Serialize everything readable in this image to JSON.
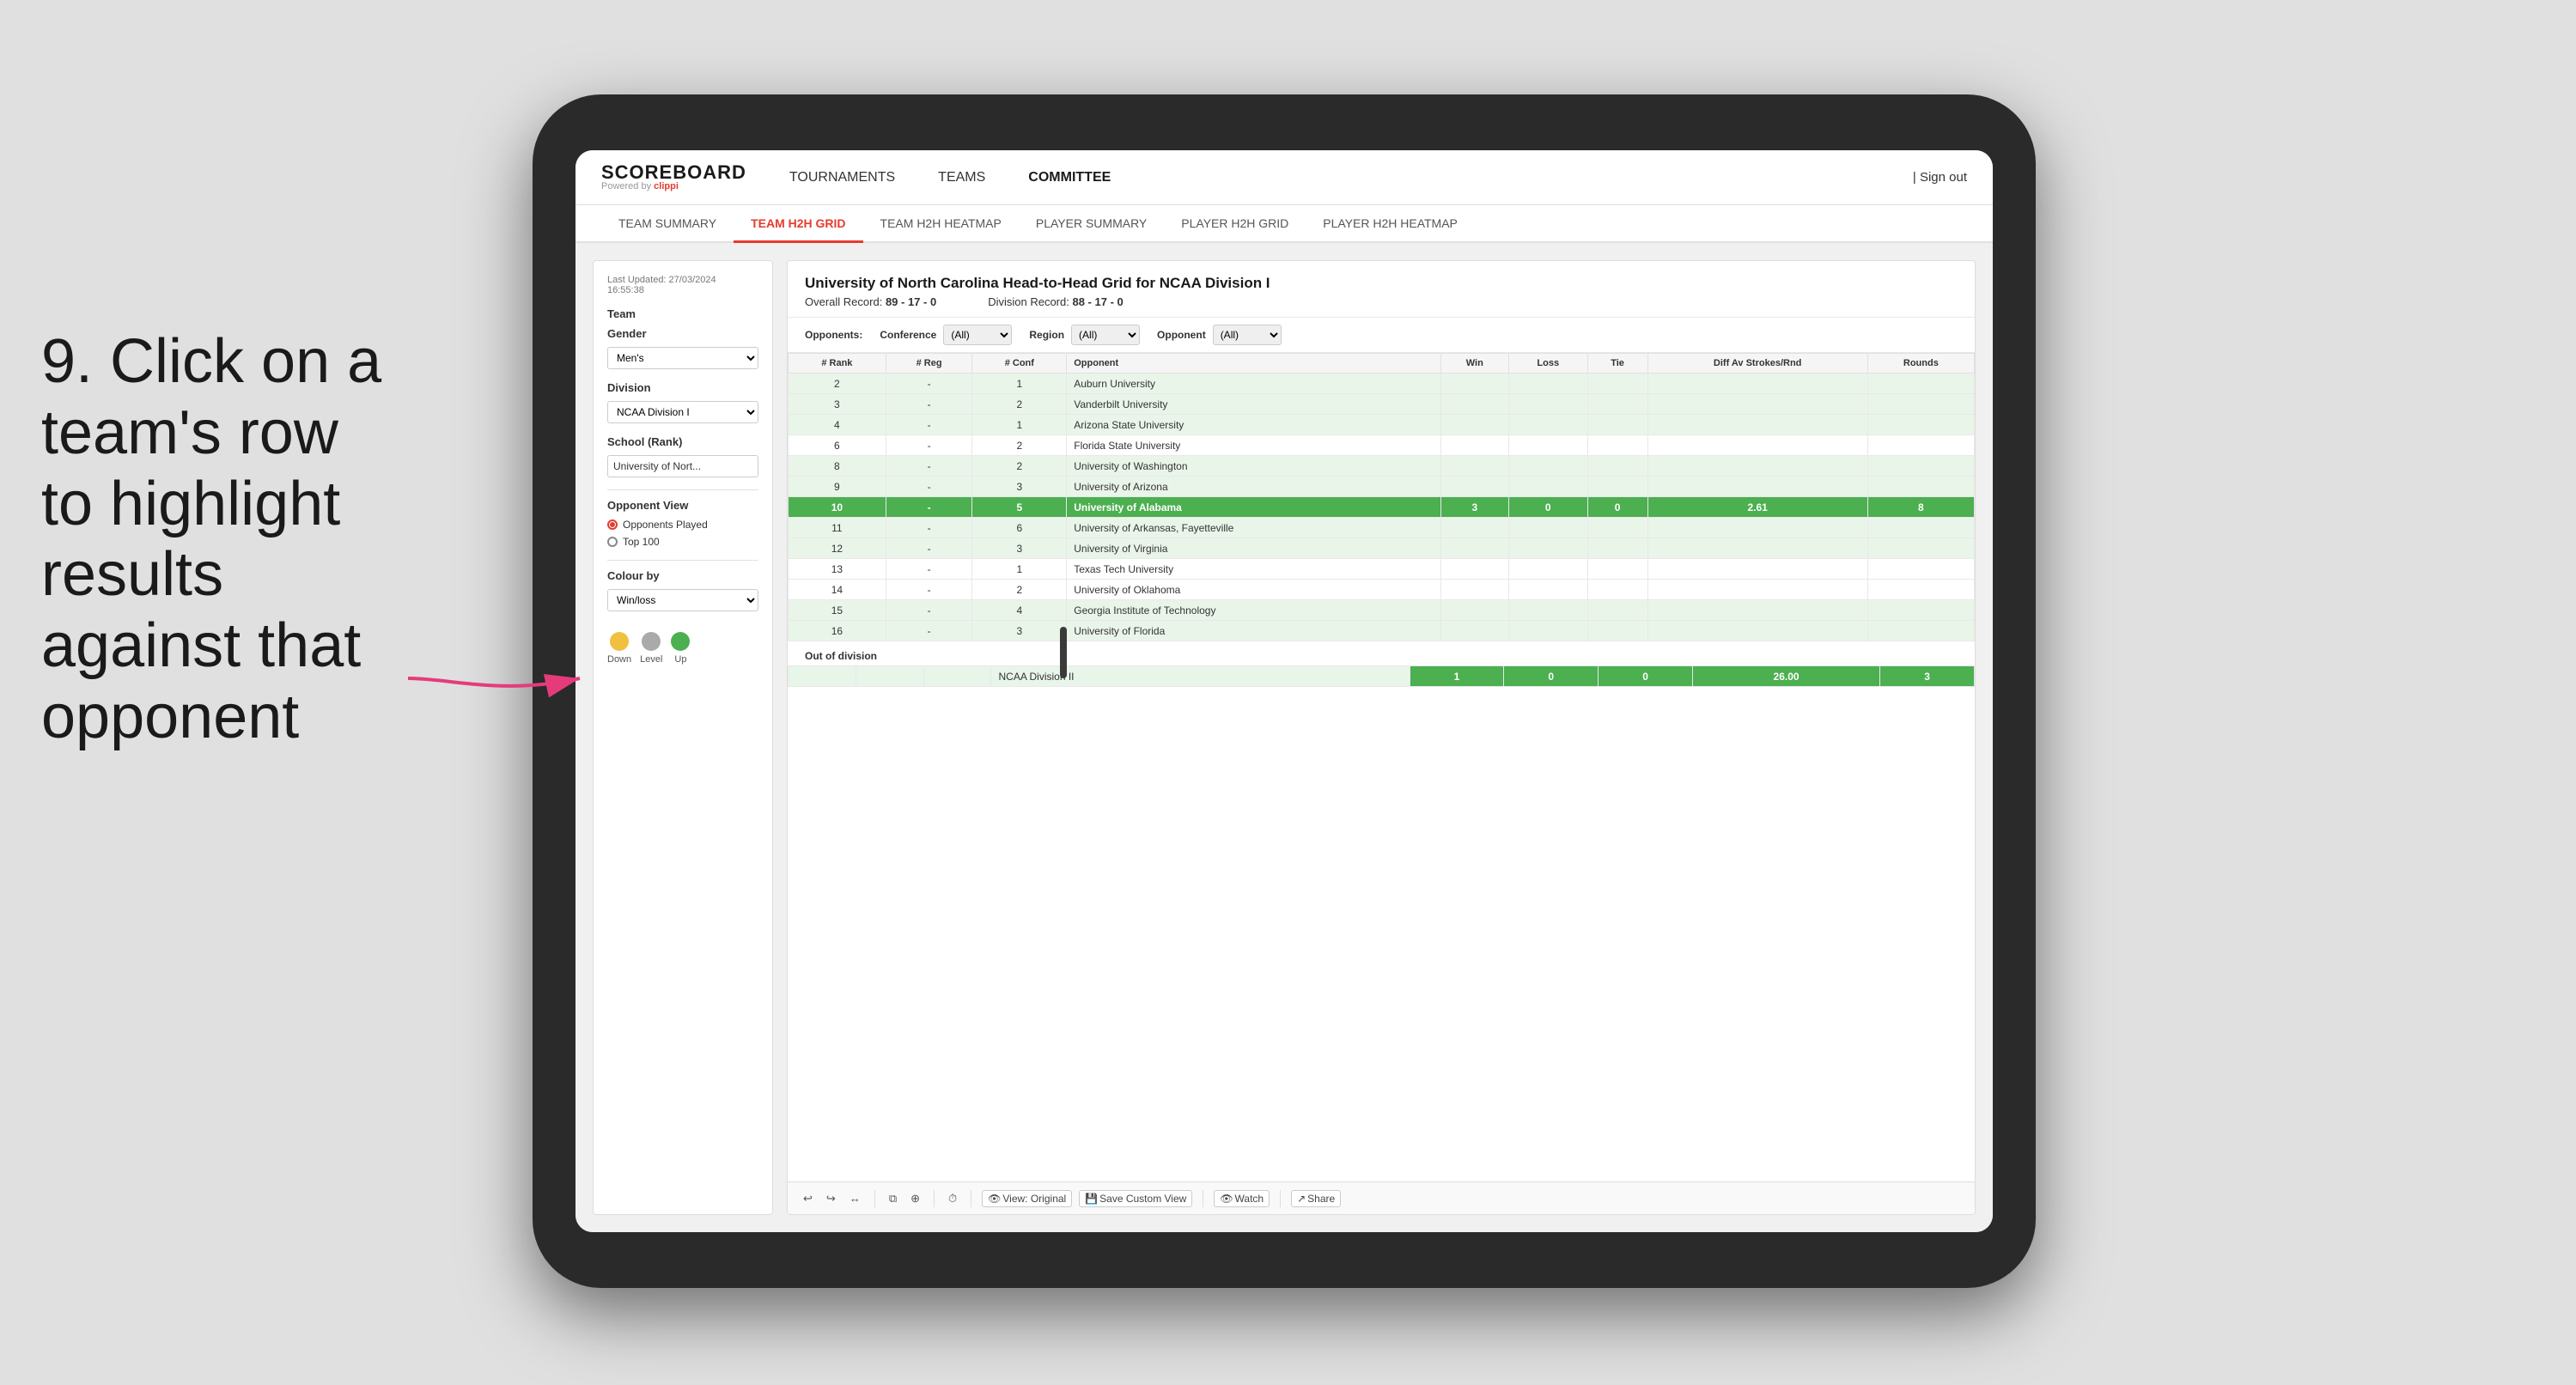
{
  "annotation": {
    "text": "9. Click on a team's row to highlight results against that opponent"
  },
  "nav": {
    "logo": "SCOREBOARD",
    "powered_by": "Powered by",
    "brand": "clippi",
    "links": [
      "TOURNAMENTS",
      "TEAMS",
      "COMMITTEE"
    ],
    "sign_in": "| Sign out"
  },
  "sub_tabs": [
    {
      "label": "TEAM SUMMARY",
      "active": false
    },
    {
      "label": "TEAM H2H GRID",
      "active": true
    },
    {
      "label": "TEAM H2H HEATMAP",
      "active": false
    },
    {
      "label": "PLAYER SUMMARY",
      "active": false
    },
    {
      "label": "PLAYER H2H GRID",
      "active": false
    },
    {
      "label": "PLAYER H2H HEATMAP",
      "active": false
    }
  ],
  "sidebar": {
    "last_updated": "Last Updated: 27/03/2024",
    "time": "16:55:38",
    "team_label": "Team",
    "gender_label": "Gender",
    "gender_value": "Men's",
    "division_label": "Division",
    "division_value": "NCAA Division I",
    "school_label": "School (Rank)",
    "school_value": "University of Nort...",
    "opponent_view_label": "Opponent View",
    "radio_1": "Opponents Played",
    "radio_2": "Top 100",
    "colour_by_label": "Colour by",
    "colour_by_value": "Win/loss",
    "legend_down": "Down",
    "legend_level": "Level",
    "legend_up": "Up"
  },
  "grid": {
    "title": "University of North Carolina Head-to-Head Grid for NCAA Division I",
    "overall_record_label": "Overall Record:",
    "overall_record_value": "89 - 17 - 0",
    "division_record_label": "Division Record:",
    "division_record_value": "88 - 17 - 0",
    "filters": {
      "opponents_label": "Opponents:",
      "conference_label": "Conference",
      "conference_value": "(All)",
      "region_label": "Region",
      "region_value": "(All)",
      "opponent_label": "Opponent",
      "opponent_value": "(All)"
    },
    "columns": [
      "# Rank",
      "# Reg",
      "# Conf",
      "Opponent",
      "Win",
      "Loss",
      "Tie",
      "Diff Av Strokes/Rnd",
      "Rounds"
    ],
    "rows": [
      {
        "rank": "2",
        "reg": "-",
        "conf": "1",
        "opponent": "Auburn University",
        "win": "",
        "loss": "",
        "tie": "",
        "diff": "",
        "rounds": "",
        "highlight": "light"
      },
      {
        "rank": "3",
        "reg": "-",
        "conf": "2",
        "opponent": "Vanderbilt University",
        "win": "",
        "loss": "",
        "tie": "",
        "diff": "",
        "rounds": "",
        "highlight": "light"
      },
      {
        "rank": "4",
        "reg": "-",
        "conf": "1",
        "opponent": "Arizona State University",
        "win": "",
        "loss": "",
        "tie": "",
        "diff": "",
        "rounds": "",
        "highlight": "light"
      },
      {
        "rank": "6",
        "reg": "-",
        "conf": "2",
        "opponent": "Florida State University",
        "win": "",
        "loss": "",
        "tie": "",
        "diff": "",
        "rounds": "",
        "highlight": "none"
      },
      {
        "rank": "8",
        "reg": "-",
        "conf": "2",
        "opponent": "University of Washington",
        "win": "",
        "loss": "",
        "tie": "",
        "diff": "",
        "rounds": "",
        "highlight": "light"
      },
      {
        "rank": "9",
        "reg": "-",
        "conf": "3",
        "opponent": "University of Arizona",
        "win": "",
        "loss": "",
        "tie": "",
        "diff": "",
        "rounds": "",
        "highlight": "light"
      },
      {
        "rank": "10",
        "reg": "-",
        "conf": "5",
        "opponent": "University of Alabama",
        "win": "3",
        "loss": "0",
        "tie": "0",
        "diff": "2.61",
        "rounds": "8",
        "highlight": "green"
      },
      {
        "rank": "11",
        "reg": "-",
        "conf": "6",
        "opponent": "University of Arkansas, Fayetteville",
        "win": "",
        "loss": "",
        "tie": "",
        "diff": "",
        "rounds": "",
        "highlight": "light"
      },
      {
        "rank": "12",
        "reg": "-",
        "conf": "3",
        "opponent": "University of Virginia",
        "win": "",
        "loss": "",
        "tie": "",
        "diff": "",
        "rounds": "",
        "highlight": "light"
      },
      {
        "rank": "13",
        "reg": "-",
        "conf": "1",
        "opponent": "Texas Tech University",
        "win": "",
        "loss": "",
        "tie": "",
        "diff": "",
        "rounds": "",
        "highlight": "none"
      },
      {
        "rank": "14",
        "reg": "-",
        "conf": "2",
        "opponent": "University of Oklahoma",
        "win": "",
        "loss": "",
        "tie": "",
        "diff": "",
        "rounds": "",
        "highlight": "none"
      },
      {
        "rank": "15",
        "reg": "-",
        "conf": "4",
        "opponent": "Georgia Institute of Technology",
        "win": "",
        "loss": "",
        "tie": "",
        "diff": "",
        "rounds": "",
        "highlight": "light"
      },
      {
        "rank": "16",
        "reg": "-",
        "conf": "3",
        "opponent": "University of Florida",
        "win": "",
        "loss": "",
        "tie": "",
        "diff": "",
        "rounds": "",
        "highlight": "light"
      }
    ],
    "out_of_division_label": "Out of division",
    "out_of_division_row": {
      "label": "NCAA Division II",
      "win": "1",
      "loss": "0",
      "tie": "0",
      "diff": "26.00",
      "rounds": "3"
    }
  },
  "toolbar": {
    "view_original": "View: Original",
    "save_custom": "Save Custom View",
    "watch": "Watch",
    "share": "Share"
  }
}
